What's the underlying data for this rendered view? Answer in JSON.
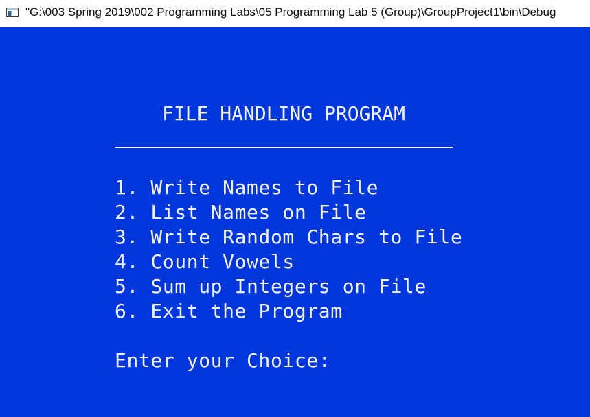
{
  "window": {
    "title": "\"G:\\003 Spring 2019\\002 Programming Labs\\05 Programming Lab 5 (Group)\\GroupProject1\\bin\\Debug",
    "icon": "console-app-icon"
  },
  "console": {
    "program_title": "FILE HANDLING PROGRAM",
    "menu": [
      {
        "number": "1.",
        "label": "Write Names to File"
      },
      {
        "number": "2.",
        "label": "List Names on File"
      },
      {
        "number": "3.",
        "label": "Write Random Chars to File"
      },
      {
        "number": "4.",
        "label": "Count Vowels"
      },
      {
        "number": "5.",
        "label": "Sum up Integers on File"
      },
      {
        "number": "6.",
        "label": "Exit the Program"
      }
    ],
    "prompt": "Enter your Choice:"
  },
  "colors": {
    "background": "#0037DA",
    "text": "#F2F2F2",
    "titlebar": "#FFFFFF"
  }
}
